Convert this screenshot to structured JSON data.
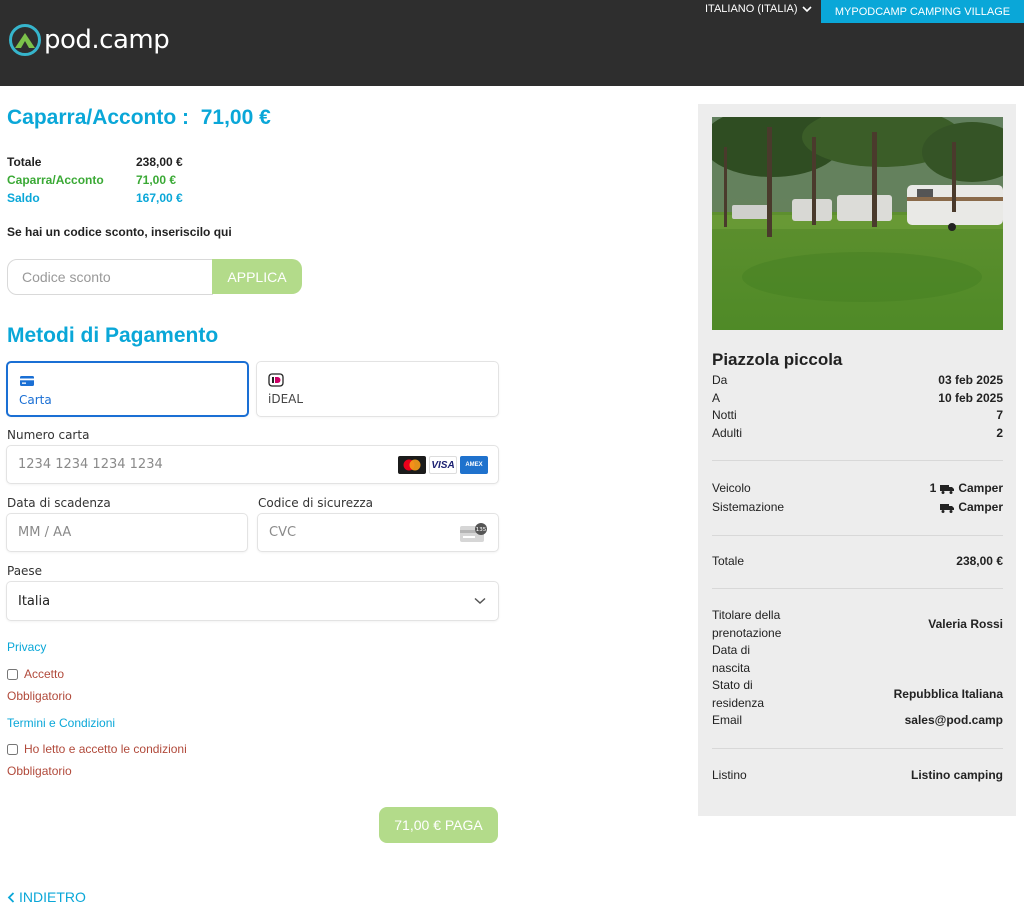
{
  "header": {
    "logo_text": "pod.camp",
    "language": "ITALIANO (ITALIA)",
    "village_button": "MYPODCAMP CAMPING VILLAGE"
  },
  "summary": {
    "deposit_title": "Caparra/Acconto :  71,00 €",
    "total_label": "Totale",
    "total_value": "238,00 €",
    "deposit_label": "Caparra/Acconto",
    "deposit_value": "71,00 €",
    "balance_label": "Saldo",
    "balance_value": "167,00 €"
  },
  "discount": {
    "label": "Se hai un codice sconto, inseriscilo qui",
    "placeholder": "Codice sconto",
    "apply": "APPLICA"
  },
  "payment": {
    "title": "Metodi di Pagamento",
    "methods": [
      {
        "label": "Carta",
        "icon": "credit-card-icon",
        "selected": true
      },
      {
        "label": "iDEAL",
        "icon": "ideal-icon",
        "selected": false
      }
    ],
    "card_number_label": "Numero carta",
    "card_number_placeholder": "1234 1234 1234 1234",
    "card_brands": [
      "mastercard",
      "VISA",
      "AMEX"
    ],
    "expiry_label": "Data di scadenza",
    "expiry_placeholder": "MM / AA",
    "cvc_label": "Codice di sicurezza",
    "cvc_placeholder": "CVC",
    "cvc_icon_text": "135",
    "country_label": "Paese",
    "country_value": "Italia"
  },
  "consents": {
    "privacy_link": "Privacy",
    "privacy_check": "Accetto",
    "privacy_required": "Obbligatorio",
    "terms_link": "Termini e Condizioni",
    "terms_check": "Ho letto e accetto le condizioni",
    "terms_required": "Obbligatorio"
  },
  "pay_button": "71,00 € PAGA",
  "back_link": "INDIETRO",
  "booking": {
    "title": "Piazzola piccola",
    "from_label": "Da",
    "from_value": "03 feb 2025",
    "to_label": "A",
    "to_value": "10 feb 2025",
    "nights_label": "Notti",
    "nights_value": "7",
    "adults_label": "Adulti",
    "adults_value": "2",
    "vehicle_label": "Veicolo",
    "vehicle_count": "1",
    "vehicle_value": "Camper",
    "accommodation_label": "Sistemazione",
    "accommodation_value": "Camper",
    "total_label": "Totale",
    "total_value": "238,00 €",
    "holder_label": "Titolare della prenotazione",
    "holder_value": "Valeria Rossi",
    "birth_label": "Data di nascita",
    "residence_label": "Stato di residenza",
    "residence_value": "Repubblica Italiana",
    "email_label": "Email",
    "email_value": "sales@pod.camp",
    "list_label": "Listino",
    "list_value": "Listino camping"
  },
  "colors": {
    "accent": "#0aa7d8",
    "header_bg": "#2e2e2e",
    "button_green": "#b3db8a",
    "deposit_green": "#3aa935",
    "error_red": "#b14a3b",
    "selected_blue": "#1a6fd4",
    "panel_bg": "#ededed"
  }
}
